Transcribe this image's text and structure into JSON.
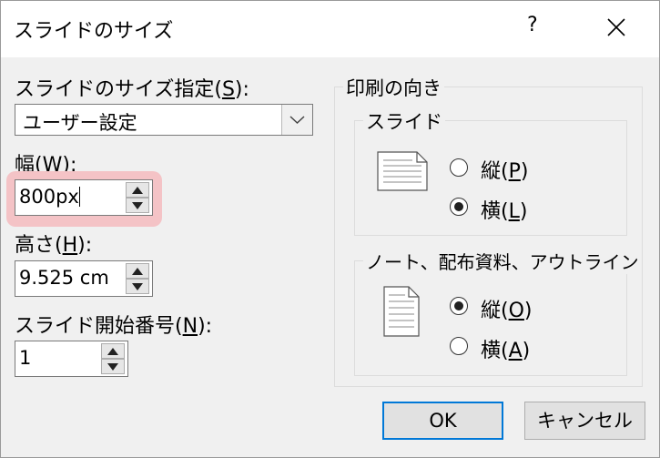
{
  "window": {
    "title": "スライドのサイズ",
    "help": "?"
  },
  "size": {
    "label_pre": "スライドのサイズ指定(",
    "label_key": "S",
    "label_post": "):",
    "selected": "ユーザー設定"
  },
  "width": {
    "label_pre": "幅(",
    "label_key": "W",
    "label_post": "):",
    "value": "800px"
  },
  "height": {
    "label_pre": "高さ(",
    "label_key": "H",
    "label_post": "):",
    "value": "9.525 cm"
  },
  "start_number": {
    "label_pre": "スライド開始番号(",
    "label_key": "N",
    "label_post": "):",
    "value": "1"
  },
  "orientation": {
    "title": "印刷の向き",
    "slides": {
      "title": "スライド",
      "portrait": {
        "pre": "縦(",
        "key": "P",
        "post": ")",
        "selected": false
      },
      "landscape": {
        "pre": "横(",
        "key": "L",
        "post": ")",
        "selected": true
      }
    },
    "notes": {
      "title": "ノート、配布資料、アウトライン",
      "portrait": {
        "pre": "縦(",
        "key": "O",
        "post": ")",
        "selected": true
      },
      "landscape": {
        "pre": "横(",
        "key": "A",
        "post": ")",
        "selected": false
      }
    }
  },
  "buttons": {
    "ok": "OK",
    "cancel": "キャンセル"
  },
  "colors": {
    "highlight": "#f4c3c6",
    "ok_border": "#0078d7"
  }
}
